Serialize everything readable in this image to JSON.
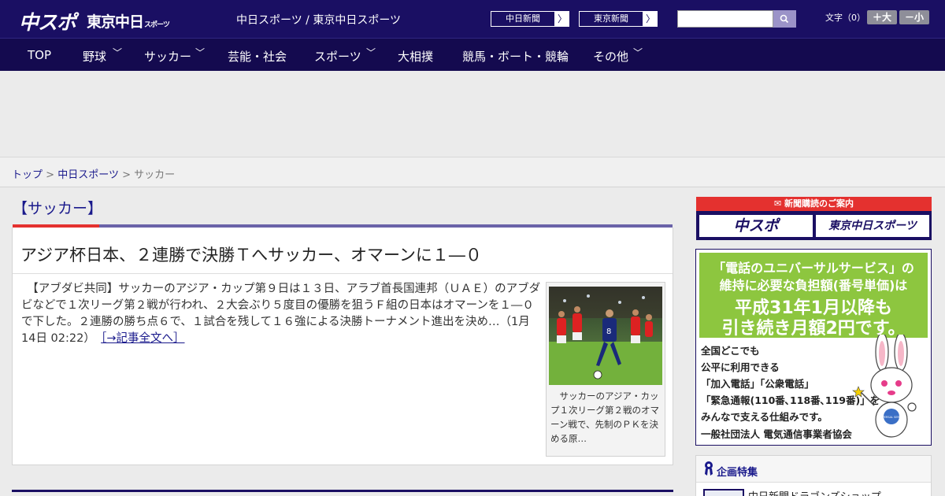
{
  "header": {
    "logo_main": "中スポ",
    "logo_tokyo": "東京中日",
    "logo_tokyo_small": "スポーツ",
    "site_links": "中日スポーツ / 東京中日スポーツ",
    "paper_buttons": [
      {
        "label": "中日新聞",
        "arrow": "〉"
      },
      {
        "label": "東京新聞",
        "arrow": "〉"
      }
    ],
    "search": {
      "placeholder": "",
      "icon": "search-icon"
    },
    "fontsize": {
      "label": "文字（0）",
      "bigger": "＋大",
      "smaller": "－小"
    }
  },
  "nav": {
    "items": [
      {
        "label": "TOP",
        "has_dropdown": false
      },
      {
        "label": "野球",
        "has_dropdown": true
      },
      {
        "label": "サッカー",
        "has_dropdown": true
      },
      {
        "label": "芸能・社会",
        "has_dropdown": false
      },
      {
        "label": "スポーツ",
        "has_dropdown": true
      },
      {
        "label": "大相撲",
        "has_dropdown": false
      },
      {
        "label": "競馬・ボート・競輪",
        "has_dropdown": false
      },
      {
        "label": "その他",
        "has_dropdown": true
      }
    ],
    "chevron": "﹀"
  },
  "breadcrumb": {
    "items": [
      "トップ",
      "中日スポーツ",
      "サッカー"
    ],
    "separator": ">"
  },
  "category": {
    "title": "【サッカー】"
  },
  "article": {
    "headline": "アジア杯日本、２連勝で決勝Ｔへサッカー、オマーンに１―０",
    "body": "　【アブダビ共同】サッカーのアジア・カップ第９日は１３日、アラブ首長国連邦（ＵＡＥ）のアブダビなどで１次リーグ第２戦が行われ、２大会ぶり５度目の優勝を狙うＦ組の日本はオマーンを１―０で下した。２連勝の勝ち点６で、１試合を残して１６強による決勝トーナメント進出を決め…",
    "timestamp": "（1月14日 02:22）",
    "more": "［→記事全文へ］",
    "photo_caption": "　サッカーのアジア・カップ１次リーグ第２戦のオマーン戦で、先制のＰＫを決める原…"
  },
  "sidebar": {
    "subscription": {
      "heading": "新聞購読のご案内",
      "logos": [
        "中スポ",
        "東京中日スポーツ"
      ]
    },
    "ad": {
      "headline_lines": [
        "「電話のユニバーサルサービス」の",
        "維持に必要な負担額(番号単価)は",
        "平成31年1月以降も",
        "引き続き月額2円です。"
      ],
      "body_lines": [
        "全国どこでも",
        "公平に利用できる",
        "「加入電話」「公衆電話」",
        "「緊急通報(110番､118番､119番)」を",
        "みんなで支える仕組みです。"
      ],
      "footer": "一般社団法人 電気通信事業者協会",
      "mascot_badge": "UNIVERSAL SERVICE"
    },
    "feature": {
      "title": "企画特集",
      "first_item": "中日新聞ドラゴンズショップ"
    }
  },
  "colors": {
    "header_bg": "#1a0f63",
    "nav_bg": "#140a4f",
    "accent_red": "#e4312f",
    "link_blue": "#1a1a8c",
    "ad_green": "#8dc63f"
  }
}
